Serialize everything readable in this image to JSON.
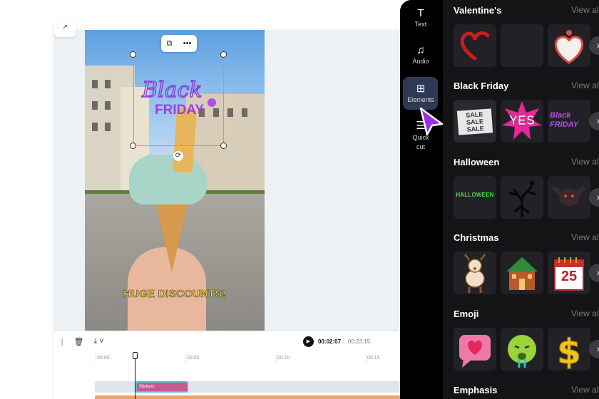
{
  "editor": {
    "corner_label": "↗",
    "caption": "HUGE DISCOUNTS!",
    "sticker": {
      "line1": "Black",
      "line2": "FRIDAY"
    },
    "float_toolbar": {
      "duplicate": "⧉",
      "more": "•••"
    }
  },
  "timeline": {
    "current_time": "00:02:07",
    "separator": "|",
    "total_time": "00:23:15",
    "ticks": [
      "00:00",
      "00:05",
      "00:10",
      "00:15"
    ],
    "clip_label": "Stickers"
  },
  "rail": {
    "items": [
      {
        "label": "Text",
        "icon": "T"
      },
      {
        "label": "Audio",
        "icon": "♫"
      },
      {
        "label": "Elements",
        "icon": "⊞"
      },
      {
        "label": "Quick cut",
        "icon": "☰"
      }
    ]
  },
  "sections": [
    {
      "title": "Valentine's",
      "view_all": "View all"
    },
    {
      "title": "Black Friday",
      "view_all": "View all",
      "tiles": [
        "SALE SALE SALE",
        "YES",
        "Black FRIDAY"
      ]
    },
    {
      "title": "Halloween",
      "view_all": "View all",
      "tiles": [
        "HALLOWEEN"
      ]
    },
    {
      "title": "Christmas",
      "view_all": "View all",
      "tiles": [
        "25"
      ]
    },
    {
      "title": "Emoji",
      "view_all": "View all"
    },
    {
      "title": "Emphasis",
      "view_all": "View all"
    }
  ],
  "colors": {
    "accent_purple": "#9b2fe0",
    "selection": "#55c0cf",
    "caption_yellow": "#f4d232",
    "panel_bg": "#141416"
  }
}
